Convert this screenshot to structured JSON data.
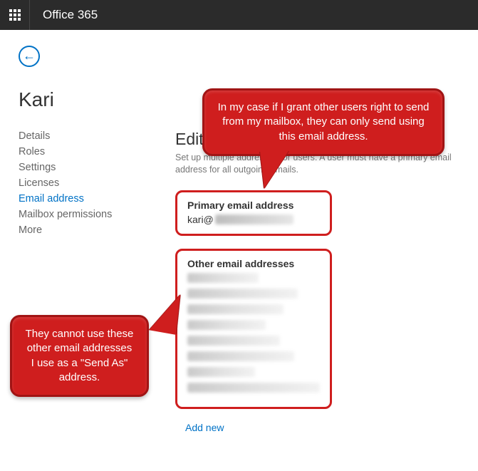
{
  "topbar": {
    "brand": "Office 365"
  },
  "page": {
    "title": "Kari"
  },
  "sidebar": {
    "items": [
      {
        "label": "Details"
      },
      {
        "label": "Roles"
      },
      {
        "label": "Settings"
      },
      {
        "label": "Licenses"
      },
      {
        "label": "Email address",
        "selected": true
      },
      {
        "label": "Mailbox permissions"
      },
      {
        "label": "More"
      }
    ]
  },
  "main": {
    "heading": "Edit email address",
    "description": "Set up multiple addresses for users. A user must have a primary email address for all outgoing emails.",
    "primary": {
      "label": "Primary email address",
      "value_prefix": "kari@"
    },
    "other": {
      "label": "Other email addresses",
      "redacted_count": 8
    },
    "add_new": "Add new"
  },
  "callouts": {
    "top": "In my case if I grant other users right to send from my mailbox, they can only send using this email address.",
    "bottom": "They cannot use these other email addresses I use as a \"Send As\" address."
  }
}
